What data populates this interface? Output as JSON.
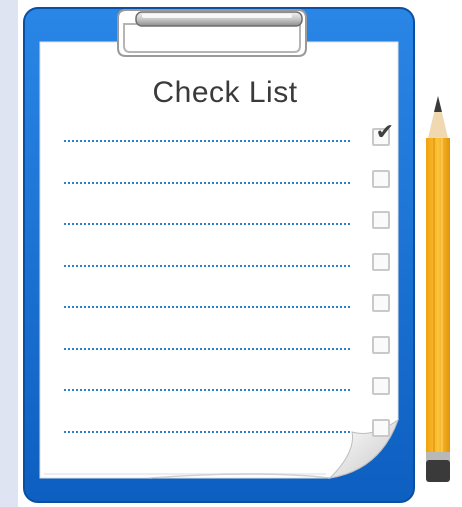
{
  "title": "Check List",
  "items": [
    {
      "checked": true
    },
    {
      "checked": false
    },
    {
      "checked": false
    },
    {
      "checked": false
    },
    {
      "checked": false
    },
    {
      "checked": false
    },
    {
      "checked": false
    },
    {
      "checked": false
    }
  ],
  "colors": {
    "clipboard": "#1e73d6",
    "paper": "#ffffff",
    "dotted_line": "#2f7fd1",
    "pencil_body": "#f7b21e",
    "pencil_tip": "#3a3a3a"
  },
  "icons": [
    "clipboard-clip-icon",
    "checkmark-icon",
    "pencil-icon"
  ]
}
